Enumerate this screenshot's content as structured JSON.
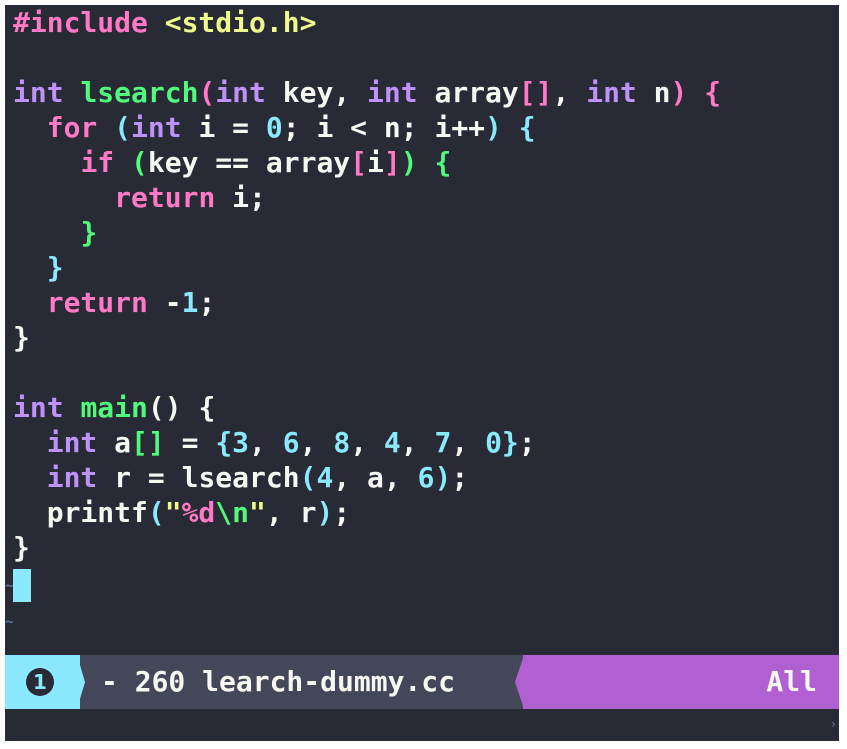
{
  "editor": {
    "lines": [
      [
        {
          "t": "#include ",
          "c": "pre"
        },
        {
          "t": "<stdio.h>",
          "c": "inc"
        }
      ],
      [],
      [
        {
          "t": "int",
          "c": "type"
        },
        {
          "t": " ",
          "c": "txt"
        },
        {
          "t": "lsearch",
          "c": "fn"
        },
        {
          "t": "(",
          "c": "b1"
        },
        {
          "t": "int",
          "c": "type"
        },
        {
          "t": " key, ",
          "c": "txt"
        },
        {
          "t": "int",
          "c": "type"
        },
        {
          "t": " array",
          "c": "txt"
        },
        {
          "t": "[]",
          "c": "sq"
        },
        {
          "t": ", ",
          "c": "txt"
        },
        {
          "t": "int",
          "c": "type"
        },
        {
          "t": " n",
          "c": "txt"
        },
        {
          "t": ")",
          "c": "b1"
        },
        {
          "t": " ",
          "c": "txt"
        },
        {
          "t": "{",
          "c": "b1"
        }
      ],
      [
        {
          "t": "  ",
          "c": "txt"
        },
        {
          "t": "for",
          "c": "kw"
        },
        {
          "t": " ",
          "c": "txt"
        },
        {
          "t": "(",
          "c": "b2"
        },
        {
          "t": "int",
          "c": "type"
        },
        {
          "t": " i = ",
          "c": "txt"
        },
        {
          "t": "0",
          "c": "num"
        },
        {
          "t": "; i < n; i++",
          "c": "txt"
        },
        {
          "t": ")",
          "c": "b2"
        },
        {
          "t": " ",
          "c": "txt"
        },
        {
          "t": "{",
          "c": "b2"
        }
      ],
      [
        {
          "t": "    ",
          "c": "txt"
        },
        {
          "t": "if",
          "c": "kw"
        },
        {
          "t": " ",
          "c": "txt"
        },
        {
          "t": "(",
          "c": "b3"
        },
        {
          "t": "key == array",
          "c": "txt"
        },
        {
          "t": "[",
          "c": "sq"
        },
        {
          "t": "i",
          "c": "txt"
        },
        {
          "t": "]",
          "c": "sq"
        },
        {
          "t": ")",
          "c": "b3"
        },
        {
          "t": " ",
          "c": "txt"
        },
        {
          "t": "{",
          "c": "b3"
        }
      ],
      [
        {
          "t": "      ",
          "c": "txt"
        },
        {
          "t": "return",
          "c": "kw"
        },
        {
          "t": " i;",
          "c": "txt"
        }
      ],
      [
        {
          "t": "    ",
          "c": "txt"
        },
        {
          "t": "}",
          "c": "b3"
        }
      ],
      [
        {
          "t": "  ",
          "c": "txt"
        },
        {
          "t": "}",
          "c": "b2"
        }
      ],
      [
        {
          "t": "  ",
          "c": "txt"
        },
        {
          "t": "return",
          "c": "kw"
        },
        {
          "t": " -",
          "c": "txt"
        },
        {
          "t": "1",
          "c": "num"
        },
        {
          "t": ";",
          "c": "txt"
        }
      ],
      [
        {
          "t": "}",
          "c": "txt"
        }
      ],
      [],
      [
        {
          "t": "int",
          "c": "type"
        },
        {
          "t": " ",
          "c": "txt"
        },
        {
          "t": "main",
          "c": "fn"
        },
        {
          "t": "()",
          "c": "txt"
        },
        {
          "t": " {",
          "c": "txt"
        }
      ],
      [
        {
          "t": "  ",
          "c": "txt"
        },
        {
          "t": "int",
          "c": "type"
        },
        {
          "t": " a",
          "c": "txt"
        },
        {
          "t": "[]",
          "c": "bl"
        },
        {
          "t": " = ",
          "c": "txt"
        },
        {
          "t": "{",
          "c": "b2"
        },
        {
          "t": "3",
          "c": "num"
        },
        {
          "t": ", ",
          "c": "txt"
        },
        {
          "t": "6",
          "c": "num"
        },
        {
          "t": ", ",
          "c": "txt"
        },
        {
          "t": "8",
          "c": "num"
        },
        {
          "t": ", ",
          "c": "txt"
        },
        {
          "t": "4",
          "c": "num"
        },
        {
          "t": ", ",
          "c": "txt"
        },
        {
          "t": "7",
          "c": "num"
        },
        {
          "t": ", ",
          "c": "txt"
        },
        {
          "t": "0",
          "c": "num"
        },
        {
          "t": "}",
          "c": "b2"
        },
        {
          "t": ";",
          "c": "txt"
        }
      ],
      [
        {
          "t": "  ",
          "c": "txt"
        },
        {
          "t": "int",
          "c": "type"
        },
        {
          "t": " r = lsearch",
          "c": "txt"
        },
        {
          "t": "(",
          "c": "b2"
        },
        {
          "t": "4",
          "c": "num"
        },
        {
          "t": ", a, ",
          "c": "txt"
        },
        {
          "t": "6",
          "c": "num"
        },
        {
          "t": ")",
          "c": "b2"
        },
        {
          "t": ";",
          "c": "txt"
        }
      ],
      [
        {
          "t": "  printf",
          "c": "txt"
        },
        {
          "t": "(",
          "c": "b2"
        },
        {
          "t": "\"",
          "c": "str"
        },
        {
          "t": "%d",
          "c": "esc"
        },
        {
          "t": "\\n",
          "c": "bl"
        },
        {
          "t": "\"",
          "c": "str"
        },
        {
          "t": ", r",
          "c": "txt"
        },
        {
          "t": ")",
          "c": "b2"
        },
        {
          "t": ";",
          "c": "txt"
        }
      ],
      [
        {
          "t": "}",
          "c": "txt"
        }
      ]
    ],
    "fringe_markers": [
      "~",
      "~"
    ]
  },
  "modeline": {
    "window_number": "1",
    "buffer_info": "- 260 learch-dummy.cc",
    "position": "All"
  },
  "minibuffer": {
    "arrow": "›"
  },
  "colors": {
    "background": "#282a36",
    "modeline_bg": "#44475a",
    "window_number_bg": "#8be9fd",
    "position_bg": "#b160d2",
    "cursor": "#8be9fd"
  }
}
